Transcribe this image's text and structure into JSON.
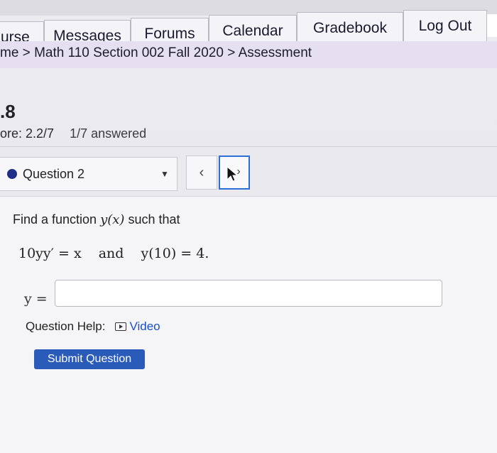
{
  "nav": {
    "tabs": [
      {
        "label": "urse"
      },
      {
        "label": "Messages"
      },
      {
        "label": "Forums"
      },
      {
        "label": "Calendar"
      },
      {
        "label": "Gradebook"
      },
      {
        "label": "Log Out"
      }
    ]
  },
  "breadcrumb": {
    "home": "me",
    "sep1": " > ",
    "course": "Math 110 Section 002 Fall 2020",
    "sep2": " > ",
    "current": "Assessment"
  },
  "assessment": {
    "number": ".8",
    "score": "ore: 2.2/7",
    "answered": "1/7 answered"
  },
  "question_nav": {
    "selected": "Question 2",
    "prev_icon": "chevron-left-icon",
    "next_icon": "chevron-right-icon"
  },
  "question": {
    "prompt_before": "Find a function ",
    "prompt_math": "y(x)",
    "prompt_after": " such that",
    "equation_left": "10yy′ = x",
    "equation_and": "and",
    "equation_right": "y(10) = 4.",
    "answer_label": "y =",
    "answer_value": ""
  },
  "help": {
    "label": "Question Help:",
    "video_label": "Video",
    "video_icon": "video-icon"
  },
  "submit": {
    "label": "Submit Question"
  },
  "colors": {
    "nav_bg": "#f4f4f8",
    "breadcrumb_bg": "#e6dff2",
    "accent": "#2a5bb8",
    "link": "#1d4fc4",
    "focus": "#2c6fd6"
  }
}
